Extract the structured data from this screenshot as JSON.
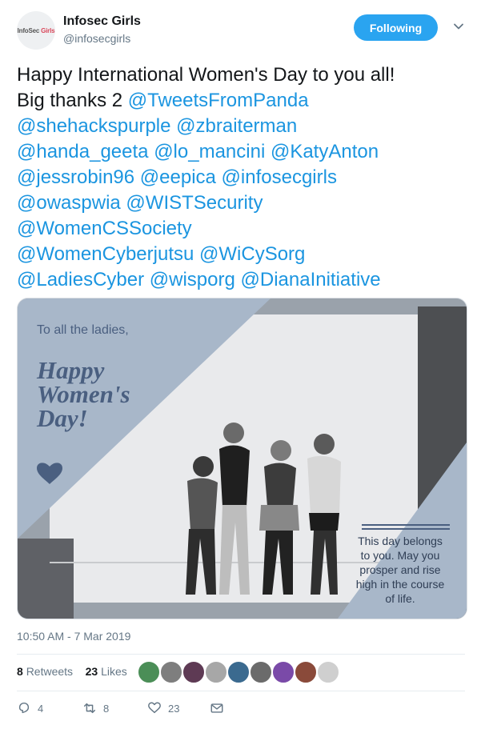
{
  "author": {
    "name": "Infosec Girls",
    "handle": "@infosecgirls",
    "avatar_text_a": "InfoSec",
    "avatar_text_b": "Girls"
  },
  "follow": {
    "label": "Following"
  },
  "tweet": {
    "line1": "Happy International Women's Day to you all!",
    "line2_prefix": "Big thanks 2 ",
    "mentions": [
      "@TweetsFromPanda",
      "@shehackspurple",
      "@zbraiterman",
      "@handa_geeta",
      "@lo_mancini",
      "@KatyAnton",
      "@jessrobin96",
      "@eepica",
      "@infosecgirls",
      "@owaspwia",
      "@WISTSecurity",
      "@WomenCSSociety",
      "@WomenCyberjutsu",
      "@WiCySorg",
      "@LadiesCyber",
      "@wisporg",
      "@DianaInitiative"
    ]
  },
  "image": {
    "greeting": "To all the ladies,",
    "title_line1": "Happy",
    "title_line2": "Women's",
    "title_line3": "Day!",
    "note_line1": "This day belongs",
    "note_line2": "to you. May you",
    "note_line3": "prosper and rise",
    "note_line4": "high in the course",
    "note_line5": "of life."
  },
  "timestamp": "10:50 AM - 7 Mar 2019",
  "stats": {
    "retweets_count": "8",
    "retweets_label": "Retweets",
    "likes_count": "23",
    "likes_label": "Likes"
  },
  "actions": {
    "reply_count": "4",
    "retweet_count": "8",
    "like_count": "23"
  },
  "colors": {
    "accent": "#1b95e0",
    "follow_bg": "#2aa4f0",
    "image_panel": "#a8b7c9",
    "image_title": "#4a5f80"
  }
}
